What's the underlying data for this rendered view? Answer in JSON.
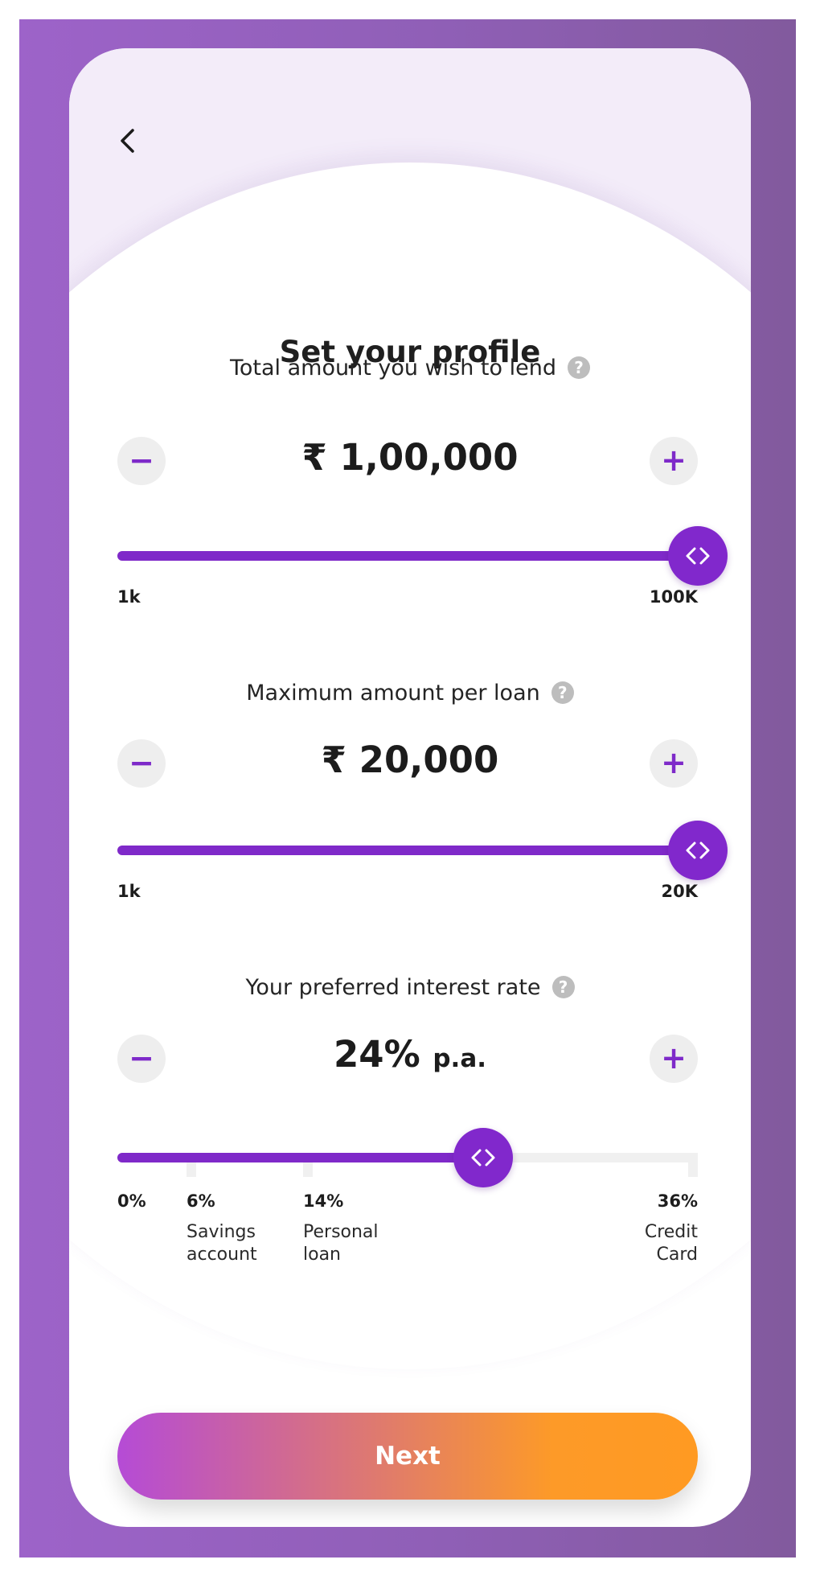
{
  "header": {
    "title": "Set your profile"
  },
  "lend_total": {
    "label": "Total amount you wish to lend",
    "help": "?",
    "value": "₹ 1,00,000",
    "min_label": "1k",
    "max_label": "100K",
    "slider_fraction": 1.0,
    "minus": "−",
    "plus": "+"
  },
  "per_loan": {
    "label": "Maximum amount per loan",
    "help": "?",
    "value": "₹ 20,000",
    "min_label": "1k",
    "max_label": "20K",
    "slider_fraction": 1.0,
    "minus": "−",
    "plus": "+"
  },
  "interest": {
    "label": "Your preferred interest rate",
    "help": "?",
    "value": "24%",
    "unit": "p.a.",
    "rate_percent": 24,
    "minus": "−",
    "plus": "+",
    "markers": [
      {
        "label": "0%",
        "caption": ""
      },
      {
        "label": "6%",
        "caption": "Savings account"
      },
      {
        "label": "14%",
        "caption": "Personal loan"
      },
      {
        "label": "36%",
        "caption": "Credit Card"
      }
    ]
  },
  "footer": {
    "next_label": "Next"
  },
  "colors": {
    "accent": "#7f29c9",
    "frame": "#9660c2",
    "next_start": "#b54bd6",
    "next_end": "#ff9a22"
  },
  "icons": {
    "back": "chevron-left-icon",
    "help": "question-circle-icon",
    "thumb": "code-arrows-icon"
  }
}
